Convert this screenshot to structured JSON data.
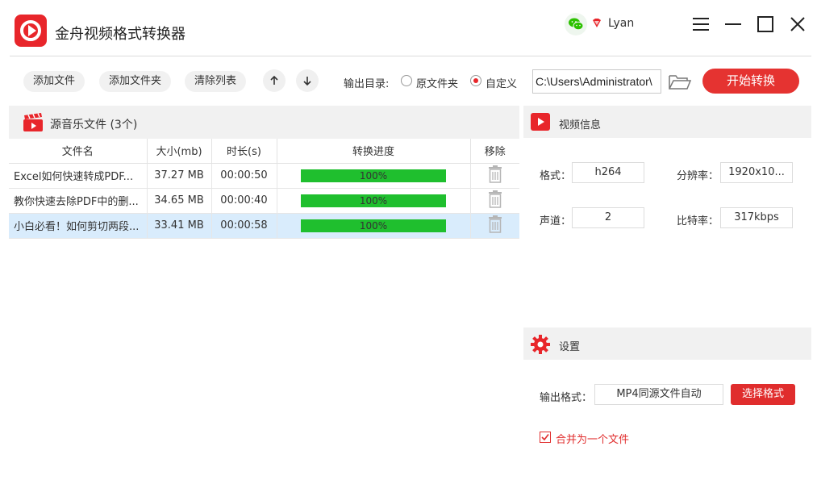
{
  "app": {
    "title": "金舟视频格式转换器",
    "username": "Lyan",
    "accent_color": "#e8262b"
  },
  "icons": {
    "logo": "video-play-logo",
    "wechat": "wechat-icon",
    "vip": "vip-diamond-icon",
    "menu": "hamburger-menu-icon",
    "minimize": "minimize-icon",
    "maximize": "maximize-icon",
    "close": "close-icon"
  },
  "toolbar": {
    "add_file": "添加文件",
    "add_folder": "添加文件夹",
    "clear_list": "清除列表",
    "output_dir_label": "输出目录:",
    "radio_source": "原文件夹",
    "radio_custom": "自定义",
    "selected_radio": "自定义",
    "output_path": "C:\\Users\\Administrator\\",
    "start_button": "开始转换"
  },
  "file_list": {
    "title": "源音乐文件 (3个)",
    "columns": [
      "文件名",
      "大小(mb)",
      "时长(s)",
      "转换进度",
      "移除"
    ],
    "rows": [
      {
        "name": "Excel如何快速转成PDF...",
        "size": "37.27 MB",
        "duration": "00:00:50",
        "progress_label": "100%",
        "progress": 1.0,
        "selected": false
      },
      {
        "name": "教你快速去除PDF中的删...",
        "size": "34.65 MB",
        "duration": "00:00:40",
        "progress_label": "100%",
        "progress": 1.0,
        "selected": false
      },
      {
        "name": "小白必看！如何剪切两段...",
        "size": "33.41 MB",
        "duration": "00:00:58",
        "progress_label": "100%",
        "progress": 1.0,
        "selected": true
      }
    ]
  },
  "video_info": {
    "title": "视频信息",
    "format_label": "格式：",
    "format_value": "h264",
    "resolution_label": "分辨率：",
    "resolution_value": "1920x10...",
    "channels_label": "声道：",
    "channels_value": "2",
    "bitrate_label": "比特率：",
    "bitrate_value": "317kbps"
  },
  "settings": {
    "title": "设置",
    "output_format_label": "输出格式：",
    "output_format_value": "MP4同源文件自动",
    "choose_format_button": "选择格式",
    "merge_label": "合并为一个文件",
    "merge_checked": true
  }
}
